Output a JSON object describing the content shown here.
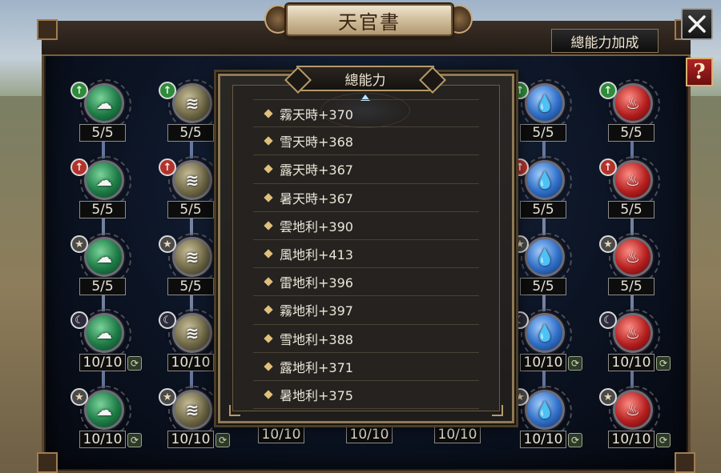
{
  "window": {
    "title": "天官書",
    "bonus_button_label": "總能力加成",
    "help_label": "?",
    "close_label": "✕"
  },
  "popup": {
    "title": "總能力",
    "stats": [
      "霧天時+370",
      "雪天時+368",
      "露天時+367",
      "暑天時+367",
      "雲地利+390",
      "風地利+413",
      "雷地利+396",
      "霧地利+397",
      "雪地利+388",
      "露地利+371",
      "暑地利+375"
    ]
  },
  "skill_columns": [
    {
      "element": "cloud",
      "glyph": "☁",
      "nodes": [
        {
          "badge": "up-green",
          "badge_glyph": "↑",
          "count": "5/5",
          "refresh": false
        },
        {
          "badge": "up-red",
          "badge_glyph": "↑",
          "count": "5/5",
          "refresh": false
        },
        {
          "badge": "star",
          "badge_glyph": "★",
          "count": "5/5",
          "refresh": false
        },
        {
          "badge": "moon",
          "badge_glyph": "☾",
          "count": "10/10",
          "refresh": true
        },
        {
          "badge": "star",
          "badge_glyph": "★",
          "count": "10/10",
          "refresh": true
        }
      ]
    },
    {
      "element": "wind",
      "glyph": "≋",
      "nodes": [
        {
          "badge": "up-green",
          "badge_glyph": "↑",
          "count": "5/5",
          "refresh": false
        },
        {
          "badge": "up-red",
          "badge_glyph": "↑",
          "count": "5/5",
          "refresh": false
        },
        {
          "badge": "star",
          "badge_glyph": "★",
          "count": "5/5",
          "refresh": false
        },
        {
          "badge": "moon",
          "badge_glyph": "☾",
          "count": "10/10",
          "refresh": true
        },
        {
          "badge": "star",
          "badge_glyph": "★",
          "count": "10/10",
          "refresh": true
        }
      ]
    },
    {
      "element": "dew",
      "glyph": "💧",
      "nodes": [
        {
          "badge": "up-green",
          "badge_glyph": "↑",
          "count": "5/5",
          "refresh": false
        },
        {
          "badge": "up-red",
          "badge_glyph": "↑",
          "count": "5/5",
          "refresh": false
        },
        {
          "badge": "star",
          "badge_glyph": "★",
          "count": "5/5",
          "refresh": false
        },
        {
          "badge": "moon",
          "badge_glyph": "☾",
          "count": "10/10",
          "refresh": true
        },
        {
          "badge": "star",
          "badge_glyph": "★",
          "count": "10/10",
          "refresh": true
        }
      ]
    },
    {
      "element": "heat",
      "glyph": "♨",
      "nodes": [
        {
          "badge": "up-green",
          "badge_glyph": "↑",
          "count": "5/5",
          "refresh": false
        },
        {
          "badge": "up-red",
          "badge_glyph": "↑",
          "count": "5/5",
          "refresh": false
        },
        {
          "badge": "star",
          "badge_glyph": "★",
          "count": "5/5",
          "refresh": false
        },
        {
          "badge": "moon",
          "badge_glyph": "☾",
          "count": "10/10",
          "refresh": true
        },
        {
          "badge": "star",
          "badge_glyph": "★",
          "count": "10/10",
          "refresh": true
        }
      ]
    }
  ],
  "hidden_counts": [
    "10/10",
    "10/10",
    "10/10"
  ],
  "refresh_icon_glyph": "⟳",
  "colors": {
    "accent_gold": "#b89a68",
    "panel_bg": "#0c1424",
    "help_red": "#b02424"
  }
}
